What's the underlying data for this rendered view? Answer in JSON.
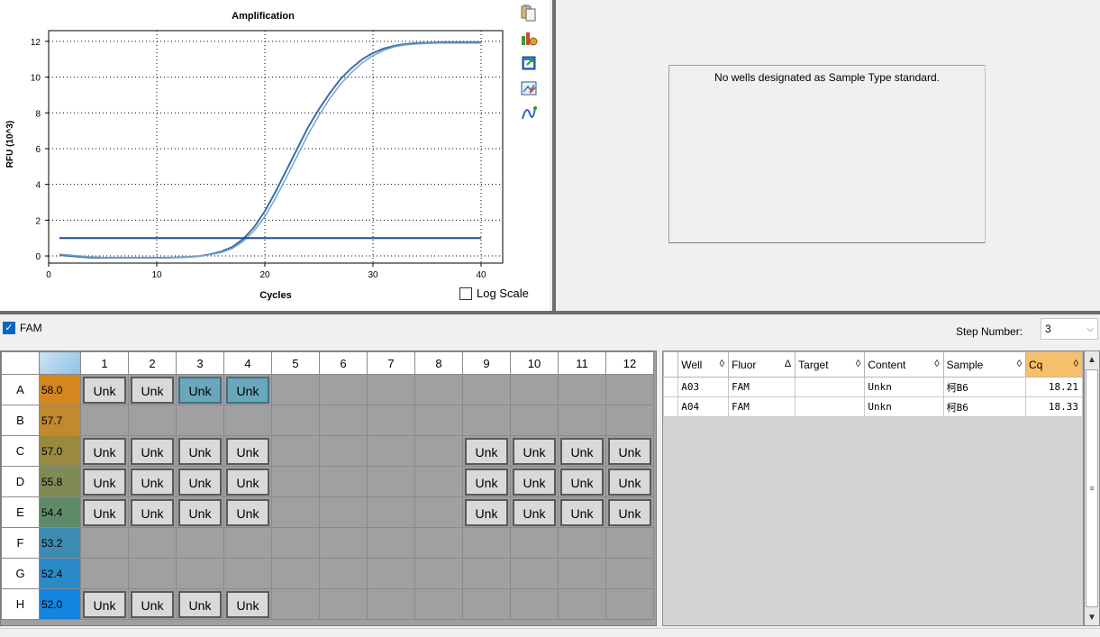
{
  "chart_data": {
    "type": "line",
    "title": "Amplification",
    "xlabel": "Cycles",
    "ylabel": "RFU (10^3)",
    "xlim": [
      0,
      42
    ],
    "ylim": [
      -0.4,
      12.6
    ],
    "xticks": [
      0,
      10,
      20,
      30,
      40
    ],
    "yticks": [
      0,
      2,
      4,
      6,
      8,
      10,
      12
    ],
    "grid": true,
    "series": [
      {
        "color": "#3a6fa8",
        "x": [
          1,
          2,
          3,
          4,
          5,
          6,
          7,
          8,
          9,
          10,
          11,
          12,
          13,
          14,
          15,
          16,
          17,
          18,
          19,
          20,
          21,
          22,
          23,
          24,
          25,
          26,
          27,
          28,
          29,
          30,
          31,
          32,
          33,
          34,
          35,
          36,
          37,
          38,
          39,
          40
        ],
        "y": [
          0.05,
          0.0,
          -0.05,
          -0.1,
          -0.1,
          -0.1,
          -0.1,
          -0.1,
          -0.1,
          -0.1,
          -0.1,
          -0.08,
          -0.05,
          0.0,
          0.1,
          0.25,
          0.5,
          0.95,
          1.6,
          2.5,
          3.6,
          4.8,
          6.0,
          7.2,
          8.2,
          9.1,
          9.9,
          10.5,
          11.0,
          11.35,
          11.6,
          11.75,
          11.85,
          11.9,
          11.92,
          11.94,
          11.95,
          11.95,
          11.95,
          11.95
        ]
      },
      {
        "color": "#7aa3c9",
        "x": [
          1,
          2,
          3,
          4,
          5,
          6,
          7,
          8,
          9,
          10,
          11,
          12,
          13,
          14,
          15,
          16,
          17,
          18,
          19,
          20,
          21,
          22,
          23,
          24,
          25,
          26,
          27,
          28,
          29,
          30,
          31,
          32,
          33,
          34,
          35,
          36,
          37,
          38,
          39,
          40
        ],
        "y": [
          0.1,
          0.05,
          0.0,
          -0.05,
          -0.08,
          -0.1,
          -0.1,
          -0.1,
          -0.1,
          -0.1,
          -0.1,
          -0.08,
          -0.05,
          0.0,
          0.08,
          0.2,
          0.42,
          0.82,
          1.4,
          2.2,
          3.25,
          4.4,
          5.6,
          6.8,
          7.85,
          8.8,
          9.6,
          10.25,
          10.8,
          11.2,
          11.5,
          11.7,
          11.8,
          11.85,
          11.88,
          11.9,
          11.9,
          11.9,
          11.9,
          11.9
        ]
      }
    ],
    "threshold": 1.0,
    "threshold_color": "#1f4e8c"
  },
  "chart": {
    "title": "Amplification",
    "xlabel": "Cycles",
    "ylabel": "RFU (10^3)",
    "log_scale_label": "Log Scale"
  },
  "std_curve": {
    "message": "No wells designated as Sample Type standard."
  },
  "fluor_filter": {
    "label": "FAM",
    "checked": true
  },
  "step": {
    "label": "Step Number:",
    "value": "3"
  },
  "plate": {
    "columns": [
      "1",
      "2",
      "3",
      "4",
      "5",
      "6",
      "7",
      "8",
      "9",
      "10",
      "11",
      "12"
    ],
    "rows": [
      {
        "label": "A",
        "temp": "58.0",
        "temp_color": "#d4871d",
        "wells": [
          "Unk",
          "Unk",
          "Unk",
          "Unk",
          "",
          "",
          "",
          "",
          "",
          "",
          "",
          ""
        ],
        "selected": [
          2,
          3
        ]
      },
      {
        "label": "B",
        "temp": "57.7",
        "temp_color": "#c08a2f",
        "wells": [
          "",
          "",
          "",
          "",
          "",
          "",
          "",
          "",
          "",
          "",
          "",
          ""
        ],
        "selected": []
      },
      {
        "label": "C",
        "temp": "57.0",
        "temp_color": "#9a8a40",
        "wells": [
          "Unk",
          "Unk",
          "Unk",
          "Unk",
          "",
          "",
          "",
          "",
          "Unk",
          "Unk",
          "Unk",
          "Unk"
        ],
        "selected": []
      },
      {
        "label": "D",
        "temp": "55.8",
        "temp_color": "#7f8a55",
        "wells": [
          "Unk",
          "Unk",
          "Unk",
          "Unk",
          "",
          "",
          "",
          "",
          "Unk",
          "Unk",
          "Unk",
          "Unk"
        ],
        "selected": []
      },
      {
        "label": "E",
        "temp": "54.4",
        "temp_color": "#5e8a6a",
        "wells": [
          "Unk",
          "Unk",
          "Unk",
          "Unk",
          "",
          "",
          "",
          "",
          "Unk",
          "Unk",
          "Unk",
          "Unk"
        ],
        "selected": []
      },
      {
        "label": "F",
        "temp": "53.2",
        "temp_color": "#3d8bb0",
        "wells": [
          "",
          "",
          "",
          "",
          "",
          "",
          "",
          "",
          "",
          "",
          "",
          ""
        ],
        "selected": []
      },
      {
        "label": "G",
        "temp": "52.4",
        "temp_color": "#2a8ac8",
        "wells": [
          "",
          "",
          "",
          "",
          "",
          "",
          "",
          "",
          "",
          "",
          "",
          ""
        ],
        "selected": []
      },
      {
        "label": "H",
        "temp": "52.0",
        "temp_color": "#1384e0",
        "wells": [
          "Unk",
          "Unk",
          "Unk",
          "Unk",
          "",
          "",
          "",
          "",
          "",
          "",
          "",
          ""
        ],
        "selected": []
      }
    ]
  },
  "results": {
    "columns": [
      {
        "label": "Well",
        "sort": "◊"
      },
      {
        "label": "Fluor",
        "sort": "Δ"
      },
      {
        "label": "Target",
        "sort": "◊"
      },
      {
        "label": "Content",
        "sort": "◊"
      },
      {
        "label": "Sample",
        "sort": "◊"
      },
      {
        "label": "Cq",
        "sort": "◊"
      }
    ],
    "rows": [
      {
        "well": "A03",
        "fluor": "FAM",
        "target": "",
        "content": "Unkn",
        "sample": "柯B6",
        "cq": "18.21"
      },
      {
        "well": "A04",
        "fluor": "FAM",
        "target": "",
        "content": "Unkn",
        "sample": "柯B6",
        "cq": "18.33"
      }
    ]
  },
  "icons": [
    "copy-icon",
    "chart-settings-icon",
    "export-icon",
    "image-export-icon",
    "curve-fit-icon"
  ]
}
